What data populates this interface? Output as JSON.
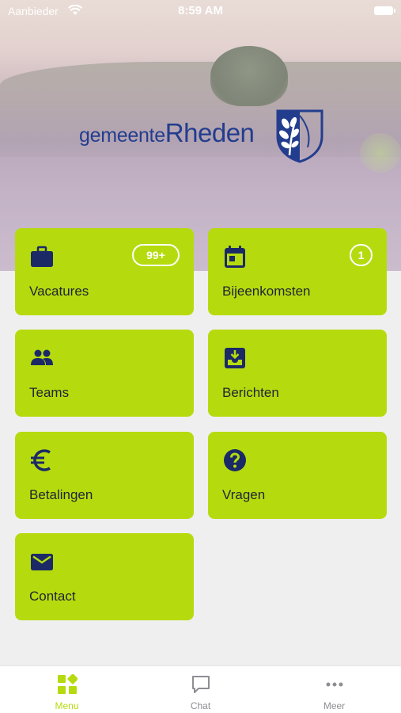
{
  "status_bar": {
    "carrier": "Aanbieder",
    "time": "8:59 AM"
  },
  "header": {
    "logo_word1": "gemeente",
    "logo_word2": "Rheden"
  },
  "tiles": [
    {
      "label": "Vacatures",
      "icon": "briefcase-icon",
      "badge": "99+"
    },
    {
      "label": "Bijeenkomsten",
      "icon": "calendar-icon",
      "badge": "1"
    },
    {
      "label": "Teams",
      "icon": "people-icon"
    },
    {
      "label": "Berichten",
      "icon": "inbox-download-icon"
    },
    {
      "label": "Betalingen",
      "icon": "euro-icon"
    },
    {
      "label": "Vragen",
      "icon": "help-circle-icon"
    },
    {
      "label": "Contact",
      "icon": "envelope-icon"
    }
  ],
  "tabbar": {
    "items": [
      {
        "label": "Menu",
        "icon": "grid-icon",
        "active": true
      },
      {
        "label": "Chat",
        "icon": "chat-bubble-icon",
        "active": false
      },
      {
        "label": "Meer",
        "icon": "more-dots-icon",
        "active": false
      }
    ]
  },
  "colors": {
    "accent": "#b5db0f",
    "navy": "#233d8e",
    "background": "#efefef",
    "icon": "#1b2a66"
  }
}
